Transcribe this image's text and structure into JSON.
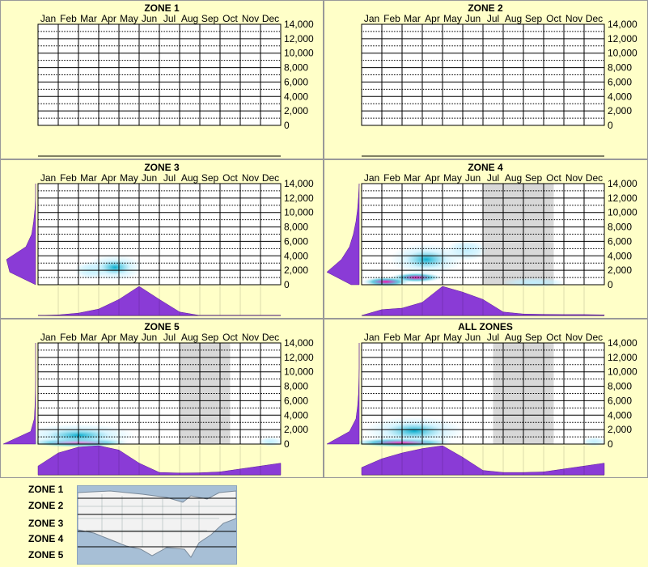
{
  "months": [
    "Jan",
    "Feb",
    "Mar",
    "Apr",
    "May",
    "Jun",
    "Jul",
    "Aug",
    "Sep",
    "Oct",
    "Nov",
    "Dec"
  ],
  "y_ticks": [
    "14,000",
    "12,000",
    "10,000",
    "8,000",
    "6,000",
    "4,000",
    "2,000",
    "0"
  ],
  "colors": {
    "background": "#ffffc8",
    "grid": "#000000",
    "density": "#8a3bd6",
    "heat_low": "#bfefff",
    "heat_mid": "#00aacc",
    "heat_high": "#0000a0",
    "heat_peak": "#ff00aa",
    "shade": "#d8d8d8"
  },
  "chart_data": [
    {
      "type": "heatmap",
      "title": "ZONE 1",
      "ylim": [
        0,
        14000
      ],
      "shaded_months": [],
      "blobs": [],
      "month_density": [],
      "elev_density": []
    },
    {
      "type": "heatmap",
      "title": "ZONE 2",
      "ylim": [
        0,
        14000
      ],
      "shaded_months": [],
      "blobs": [],
      "month_density": [],
      "elev_density": []
    },
    {
      "type": "heatmap",
      "title": "ZONE 3",
      "ylim": [
        0,
        14000
      ],
      "shaded_months": [],
      "blobs": [
        {
          "month": 3.8,
          "elev": 2400,
          "w": 1.4,
          "h": 1800,
          "level": 0.3
        },
        {
          "month": 2.6,
          "elev": 2000,
          "w": 0.8,
          "h": 1200,
          "level": 0.15
        }
      ],
      "month_density": [
        0,
        0.02,
        0.08,
        0.22,
        0.55,
        1.0,
        0.55,
        0.12,
        0,
        0,
        0,
        0,
        0
      ],
      "elev_density": [
        0.0,
        0.8,
        0.9,
        0.3,
        0.12,
        0.06,
        0.02,
        0,
        0
      ]
    },
    {
      "type": "heatmap",
      "title": "ZONE 4",
      "ylim": [
        0,
        14000
      ],
      "shaded_months": [
        6.0,
        9.5
      ],
      "blobs": [
        {
          "month": 2.7,
          "elev": 1000,
          "w": 1.3,
          "h": 700,
          "level": 1.0
        },
        {
          "month": 1.2,
          "elev": 400,
          "w": 1.2,
          "h": 600,
          "level": 0.85
        },
        {
          "month": 3.2,
          "elev": 3500,
          "w": 1.8,
          "h": 2200,
          "level": 0.35
        },
        {
          "month": 5.2,
          "elev": 4800,
          "w": 1.0,
          "h": 1500,
          "level": 0.15
        },
        {
          "month": 8.5,
          "elev": 300,
          "w": 1.6,
          "h": 300,
          "level": 0.12
        }
      ],
      "month_density": [
        0,
        0.2,
        0.25,
        0.45,
        1.0,
        0.8,
        0.55,
        0.12,
        0.05,
        0.04,
        0.03,
        0.03,
        0.02
      ],
      "elev_density": [
        0.25,
        1.0,
        0.55,
        0.3,
        0.18,
        0.1,
        0.05,
        0.02,
        0
      ]
    },
    {
      "type": "heatmap",
      "title": "ZONE 5",
      "ylim": [
        0,
        14000
      ],
      "shaded_months": [
        7.0,
        9.5
      ],
      "blobs": [
        {
          "month": 2.0,
          "elev": 200,
          "w": 2.6,
          "h": 300,
          "level": 1.0
        },
        {
          "month": 2.0,
          "elev": 1200,
          "w": 2.8,
          "h": 1600,
          "level": 0.3
        },
        {
          "month": 11.5,
          "elev": 300,
          "w": 0.6,
          "h": 400,
          "level": 0.25
        }
      ],
      "month_density": [
        0.3,
        0.75,
        0.95,
        1.0,
        0.85,
        0.4,
        0.08,
        0.06,
        0.07,
        0.1,
        0.2,
        0.3,
        0.4
      ],
      "elev_density": [
        1.0,
        0.15,
        0.04,
        0.02,
        0.01,
        0,
        0,
        0,
        0
      ]
    },
    {
      "type": "heatmap",
      "title": "ALL ZONES",
      "ylim": [
        0,
        14000
      ],
      "shaded_months": [
        6.5,
        9.5
      ],
      "blobs": [
        {
          "month": 2.0,
          "elev": 200,
          "w": 2.6,
          "h": 300,
          "level": 1.0
        },
        {
          "month": 2.6,
          "elev": 1800,
          "w": 2.5,
          "h": 2000,
          "level": 0.3
        },
        {
          "month": 11.5,
          "elev": 300,
          "w": 0.6,
          "h": 400,
          "level": 0.25
        }
      ],
      "month_density": [
        0.25,
        0.55,
        0.75,
        0.9,
        1.0,
        0.6,
        0.15,
        0.08,
        0.08,
        0.1,
        0.2,
        0.3,
        0.4
      ],
      "elev_density": [
        1.0,
        0.3,
        0.1,
        0.05,
        0.02,
        0.01,
        0,
        0,
        0
      ]
    }
  ],
  "legend": {
    "zone_labels": [
      "ZONE 1",
      "ZONE 2",
      "ZONE 3",
      "ZONE 4",
      "ZONE 5"
    ]
  }
}
